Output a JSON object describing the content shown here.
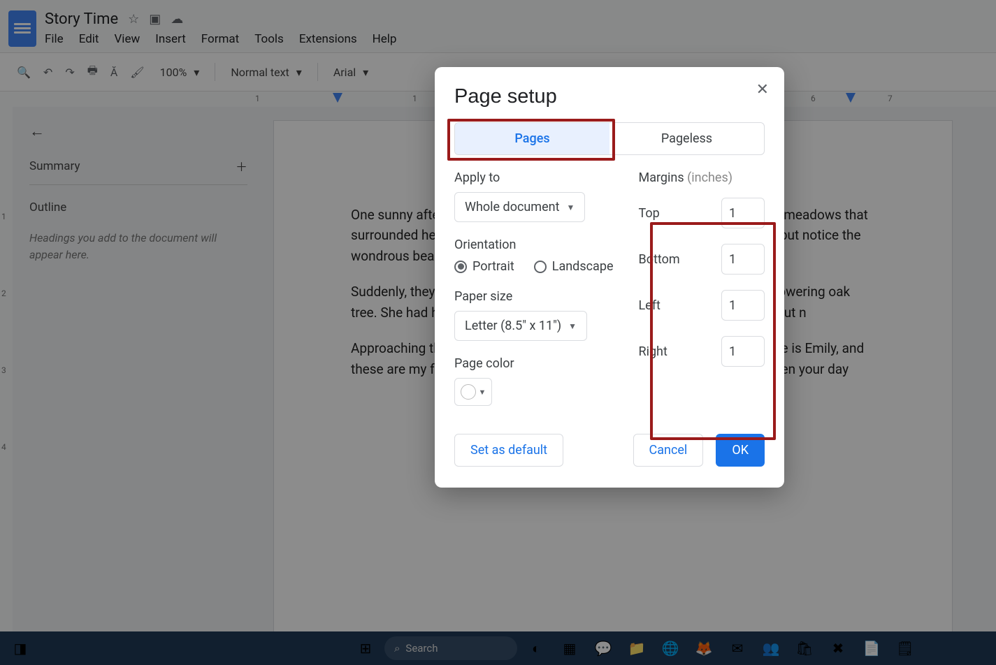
{
  "header": {
    "doc_title": "Story Time",
    "menus": [
      "File",
      "Edit",
      "View",
      "Insert",
      "Format",
      "Tools",
      "Extensions",
      "Help"
    ]
  },
  "toolbar": {
    "zoom": "100%",
    "style": "Normal text",
    "font": "Arial"
  },
  "ruler": {
    "ticks": [
      "1",
      "1",
      "2",
      "6",
      "7"
    ]
  },
  "vruler": {
    "ticks": [
      "1",
      "2",
      "3",
      "4"
    ]
  },
  "sidebar": {
    "summary_label": "Summary",
    "outline_label": "Outline",
    "hint": "Headings you add to the document will appear here."
  },
  "document": {
    "p1": "One sunny afternoon, a little girl named Emily went for a walk through the meadows that surrounded her village. As she wandered off the path, Emily couldn't help but notice the wondrous beauty around her—the brilliant wildflowers, the r",
    "p2": "Suddenly, they came across an old woman sitting on a bench beneath a towering oak tree. She had her eyes closed, and her face showed both joy and sorrow, but n",
    "p3": "Approaching the old woman, Emily gently said, \"Hello there, dear. My name is Emily, and these are my friends. We wondered if there's anything we can do to brighten your day"
  },
  "dialog": {
    "title": "Page setup",
    "tab_pages": "Pages",
    "tab_pageless": "Pageless",
    "apply_label": "Apply to",
    "apply_value": "Whole document",
    "orientation_label": "Orientation",
    "orientation_portrait": "Portrait",
    "orientation_landscape": "Landscape",
    "paper_label": "Paper size",
    "paper_value": "Letter (8.5\" x 11\")",
    "pagecolor_label": "Page color",
    "margins_label": "Margins",
    "margins_unit": "(inches)",
    "margins": {
      "top_label": "Top",
      "top": "1",
      "bottom_label": "Bottom",
      "bottom": "1",
      "left_label": "Left",
      "left": "1",
      "right_label": "Right",
      "right": "1"
    },
    "set_default": "Set as default",
    "cancel": "Cancel",
    "ok": "OK"
  },
  "taskbar": {
    "search_placeholder": "Search"
  }
}
